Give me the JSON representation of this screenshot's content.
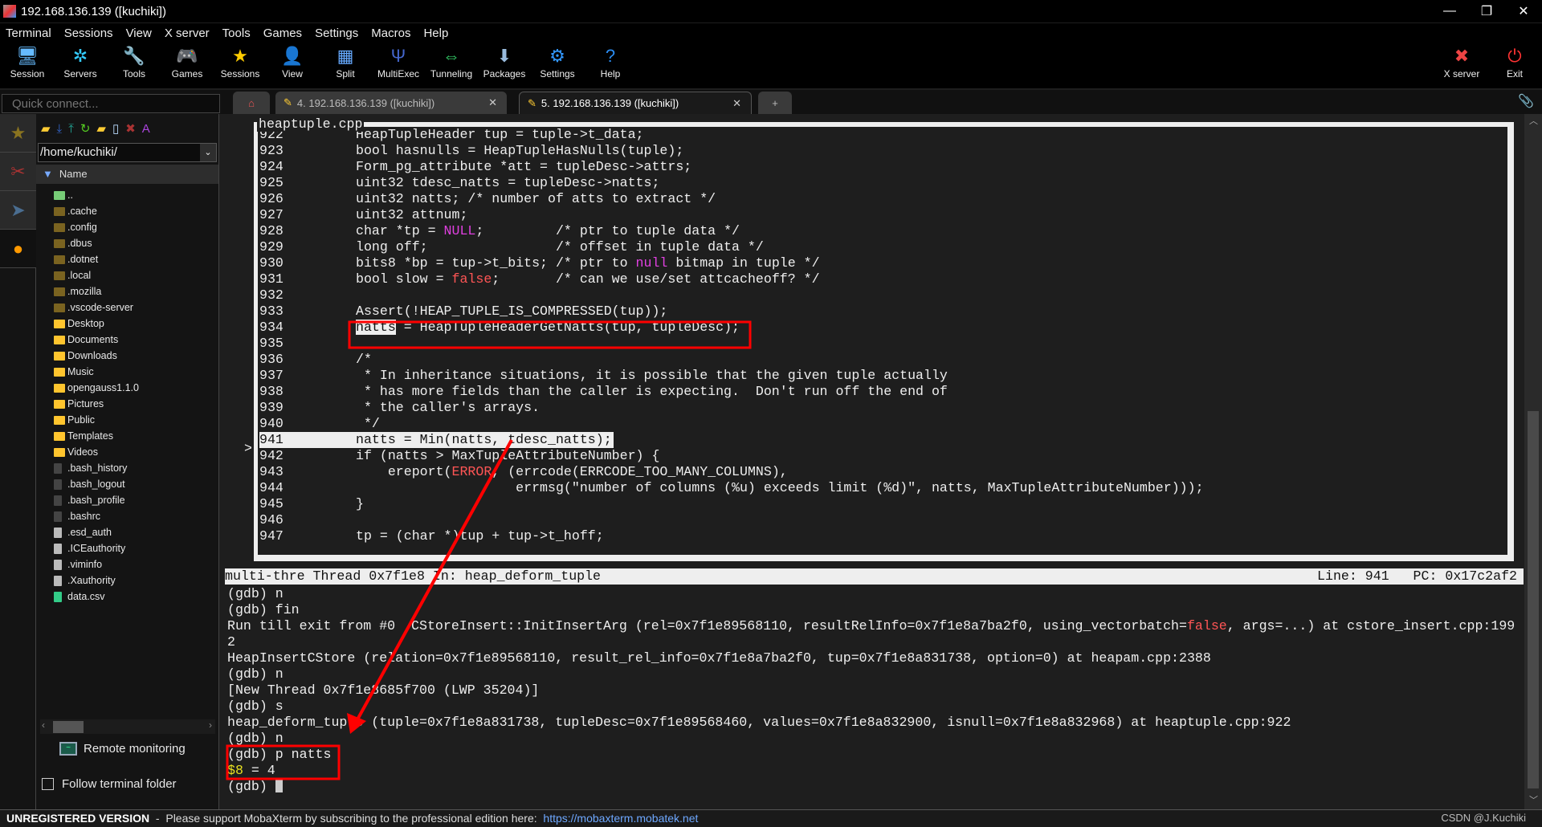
{
  "window": {
    "title": "192.168.136.139 ([kuchiki])"
  },
  "menu": [
    "Terminal",
    "Sessions",
    "View",
    "X server",
    "Tools",
    "Games",
    "Settings",
    "Macros",
    "Help"
  ],
  "toolbar": [
    {
      "label": "Session",
      "icon": "session-icon",
      "glyph": "🖥"
    },
    {
      "label": "Servers",
      "icon": "servers-icon",
      "glyph": "✲"
    },
    {
      "label": "Tools",
      "icon": "tools-icon",
      "glyph": "🔧"
    },
    {
      "label": "Games",
      "icon": "games-icon",
      "glyph": "🎮"
    },
    {
      "label": "Sessions",
      "icon": "sessions-star-icon",
      "glyph": "★"
    },
    {
      "label": "View",
      "icon": "view-icon",
      "glyph": "👤"
    },
    {
      "label": "Split",
      "icon": "split-icon",
      "glyph": "▦"
    },
    {
      "label": "MultiExec",
      "icon": "multiexec-icon",
      "glyph": "Ψ"
    },
    {
      "label": "Tunneling",
      "icon": "tunneling-icon",
      "glyph": "⇔"
    },
    {
      "label": "Packages",
      "icon": "packages-icon",
      "glyph": "⬇"
    },
    {
      "label": "Settings",
      "icon": "settings-icon",
      "glyph": "⚙"
    },
    {
      "label": "Help",
      "icon": "help-icon",
      "glyph": "?"
    }
  ],
  "toolbar_right": [
    {
      "label": "X server",
      "icon": "x-server-icon",
      "glyph": "✖"
    },
    {
      "label": "Exit",
      "icon": "power-icon",
      "glyph": "⏻"
    }
  ],
  "quick_connect": {
    "placeholder": "Quick connect..."
  },
  "tabs": [
    {
      "label": "4. 192.168.136.139 ([kuchiki])",
      "active": false
    },
    {
      "label": "5. 192.168.136.139 ([kuchiki])",
      "active": true
    }
  ],
  "sftp": {
    "path": "/home/kuchiki/",
    "column": "Name",
    "files": [
      {
        "name": "..",
        "kind": "up"
      },
      {
        "name": ".cache",
        "kind": "hidden-folder"
      },
      {
        "name": ".config",
        "kind": "hidden-folder"
      },
      {
        "name": ".dbus",
        "kind": "hidden-folder"
      },
      {
        "name": ".dotnet",
        "kind": "hidden-folder"
      },
      {
        "name": ".local",
        "kind": "hidden-folder"
      },
      {
        "name": ".mozilla",
        "kind": "hidden-folder"
      },
      {
        "name": ".vscode-server",
        "kind": "hidden-folder"
      },
      {
        "name": "Desktop",
        "kind": "folder"
      },
      {
        "name": "Documents",
        "kind": "folder"
      },
      {
        "name": "Downloads",
        "kind": "folder"
      },
      {
        "name": "Music",
        "kind": "folder"
      },
      {
        "name": "opengauss1.1.0",
        "kind": "folder"
      },
      {
        "name": "Pictures",
        "kind": "folder"
      },
      {
        "name": "Public",
        "kind": "folder"
      },
      {
        "name": "Templates",
        "kind": "folder"
      },
      {
        "name": "Videos",
        "kind": "folder"
      },
      {
        "name": ".bash_history",
        "kind": "hidden-file"
      },
      {
        "name": ".bash_logout",
        "kind": "hidden-file"
      },
      {
        "name": ".bash_profile",
        "kind": "hidden-file"
      },
      {
        "name": ".bashrc",
        "kind": "hidden-file"
      },
      {
        "name": ".esd_auth",
        "kind": "file"
      },
      {
        "name": ".ICEauthority",
        "kind": "file"
      },
      {
        "name": ".viminfo",
        "kind": "file"
      },
      {
        "name": ".Xauthority",
        "kind": "file"
      },
      {
        "name": "data.csv",
        "kind": "csv"
      }
    ],
    "remote_monitoring": "Remote monitoring",
    "follow_folder": "Follow terminal folder",
    "follow_checked": false
  },
  "code": {
    "filename": "heaptuple.cpp",
    "current_line": "941",
    "lines": [
      {
        "n": "922",
        "s": [
          [
            "HeapTupleHeader tup = tuple->t_data;"
          ]
        ]
      },
      {
        "n": "923",
        "s": [
          [
            "bool hasnulls = HeapTupleHasNulls(tuple);"
          ]
        ]
      },
      {
        "n": "924",
        "s": [
          [
            "Form_pg_attribute *att = tupleDesc->attrs;"
          ]
        ]
      },
      {
        "n": "925",
        "s": [
          [
            "uint32 tdesc_natts = tupleDesc->natts;"
          ]
        ]
      },
      {
        "n": "926",
        "s": [
          [
            "uint32 natts; /* number of atts to extract */"
          ]
        ]
      },
      {
        "n": "927",
        "s": [
          [
            "uint32 attnum;"
          ]
        ]
      },
      {
        "n": "928",
        "s": [
          [
            "char *tp = "
          ],
          [
            "NULL",
            "#e040e0"
          ],
          [
            ";         /* ptr to tuple data */"
          ]
        ]
      },
      {
        "n": "929",
        "s": [
          [
            "long off;                /* offset in tuple data */"
          ]
        ]
      },
      {
        "n": "930",
        "s": [
          [
            "bits8 *bp = tup->t_bits; /* ptr to "
          ],
          [
            "null",
            "#e040e0"
          ],
          [
            " bitmap in tuple */"
          ]
        ]
      },
      {
        "n": "931",
        "s": [
          [
            "bool slow = "
          ],
          [
            "false",
            "#ff5555"
          ],
          [
            ";       /* can we use/set attcacheoff? */"
          ]
        ]
      },
      {
        "n": "932",
        "s": [
          [
            ""
          ]
        ]
      },
      {
        "n": "933",
        "s": [
          [
            "Assert(!HEAP_TUPLE_IS_COMPRESSED(tup));"
          ]
        ]
      },
      {
        "n": "934",
        "s": [
          [
            "natts",
            "hl"
          ],
          [
            " = HeapTupleHeaderGetNatts(tup, tupleDesc);"
          ]
        ]
      },
      {
        "n": "935",
        "s": [
          [
            ""
          ]
        ]
      },
      {
        "n": "936",
        "s": [
          [
            "/*"
          ]
        ]
      },
      {
        "n": "937",
        "s": [
          [
            " * In inheritance situations, it is possible that the given tuple actually"
          ]
        ]
      },
      {
        "n": "938",
        "s": [
          [
            " * has more fields than the caller is expecting.  Don't run off the end of"
          ]
        ]
      },
      {
        "n": "939",
        "s": [
          [
            " * the caller's arrays."
          ]
        ]
      },
      {
        "n": "940",
        "s": [
          [
            " */"
          ]
        ]
      },
      {
        "n": "941",
        "s": [
          [
            "natts = Min(natts, tdesc_natts);"
          ]
        ]
      },
      {
        "n": "942",
        "s": [
          [
            "if (natts > MaxTupleAttributeNumber) {"
          ]
        ]
      },
      {
        "n": "943",
        "s": [
          [
            "    ereport("
          ],
          [
            "ERROR",
            "#ff5555"
          ],
          [
            ", (errcode(ERRCODE_TOO_MANY_COLUMNS),"
          ]
        ]
      },
      {
        "n": "944",
        "s": [
          [
            "                    errmsg(\"number of columns (%u) exceeds limit (%d)\", natts, MaxTupleAttributeNumber)));"
          ]
        ]
      },
      {
        "n": "945",
        "s": [
          [
            "}"
          ]
        ]
      },
      {
        "n": "946",
        "s": [
          [
            ""
          ]
        ]
      },
      {
        "n": "947",
        "s": [
          [
            "tp = (char *)tup + tup->t_hoff;"
          ]
        ]
      }
    ]
  },
  "status": {
    "left": "multi-thre Thread 0x7f1e8 In: heap_deform_tuple",
    "right": "Line: 941   PC: 0x17c2af2"
  },
  "gdb": [
    [
      [
        "(gdb) n"
      ]
    ],
    [
      [
        "(gdb) fin"
      ]
    ],
    [
      [
        "Run till exit from #0  CStoreInsert::InitInsertArg (rel=0x7f1e89568110, resultRelInfo=0x7f1e8a7ba2f0, using_vectorbatch="
      ],
      [
        "false",
        "#ff5555"
      ],
      [
        ", args=...) at cstore_insert.cpp:199"
      ]
    ],
    [
      [
        "2"
      ]
    ],
    [
      [
        "HeapInsertCStore (relation=0x7f1e89568110, result_rel_info=0x7f1e8a7ba2f0, tup=0x7f1e8a831738, option=0) at heapam.cpp:2388"
      ]
    ],
    [
      [
        "(gdb) n"
      ]
    ],
    [
      [
        "[New Thread 0x7f1e8685f700 (LWP 35204)]"
      ]
    ],
    [
      [
        "(gdb) s"
      ]
    ],
    [
      [
        "heap_deform_tuple (tuple=0x7f1e8a831738, tupleDesc=0x7f1e89568460, values=0x7f1e8a832900, isnull=0x7f1e8a832968) at heaptuple.cpp:922"
      ]
    ],
    [
      [
        "(gdb) n"
      ]
    ],
    [
      [
        "(gdb) p natts"
      ]
    ],
    [
      [
        "$8",
        "#e8e020"
      ],
      [
        " = 4"
      ]
    ],
    [
      [
        "(gdb) "
      ],
      [
        "",
        "cursor"
      ]
    ]
  ],
  "footer": {
    "label": "UNREGISTERED VERSION",
    "text": "  -  Please support MobaXterm by subscribing to the professional edition here:  ",
    "link": "https://mobaxterm.mobatek.net"
  },
  "watermark": "CSDN @J.Kuchiki",
  "colors": {
    "annotation": "#ff0000",
    "accent_link": "#6ea8ff"
  }
}
